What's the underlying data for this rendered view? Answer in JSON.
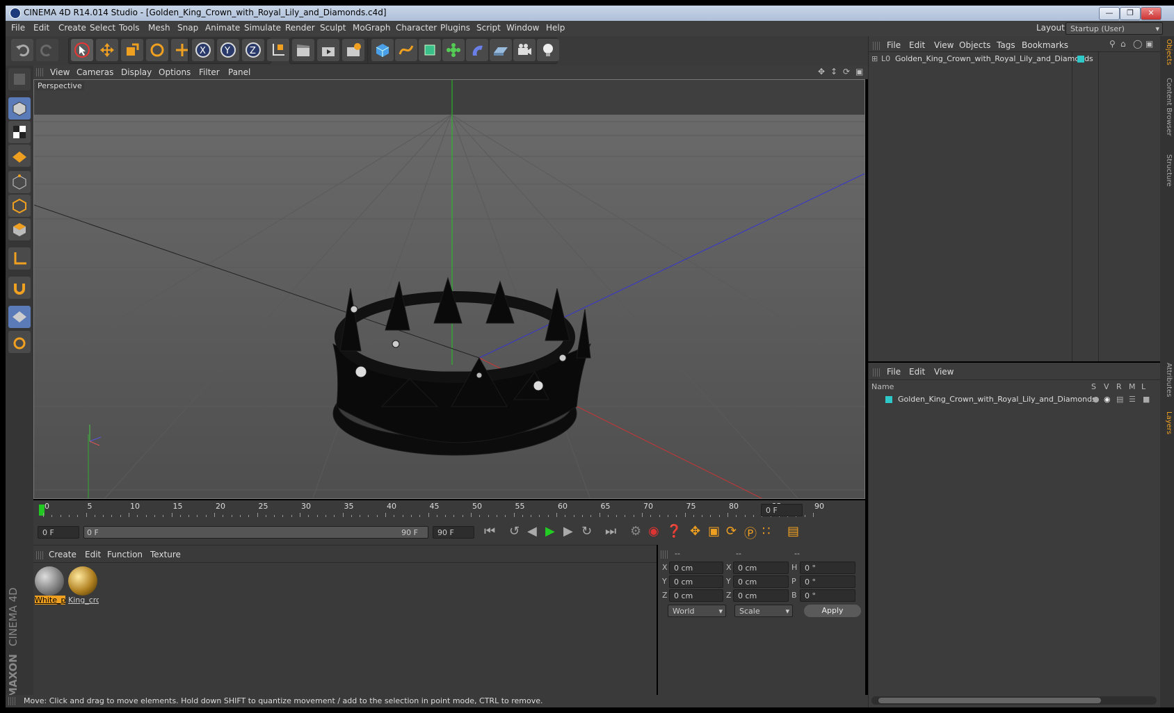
{
  "window": {
    "title": "CINEMA 4D R14.014 Studio - [Golden_King_Crown_with_Royal_Lily_and_Diamonds.c4d]"
  },
  "menu": [
    "File",
    "Edit",
    "Create",
    "Select",
    "Tools",
    "Mesh",
    "Snap",
    "Animate",
    "Simulate",
    "Render",
    "Sculpt",
    "MoGraph",
    "Character",
    "Plugins",
    "Script",
    "Window",
    "Help"
  ],
  "layout": {
    "label": "Layout:",
    "value": "Startup (User)"
  },
  "viewport": {
    "menu": [
      "View",
      "Cameras",
      "Display",
      "Options",
      "Filter",
      "Panel"
    ],
    "label": "Perspective"
  },
  "timeline": {
    "ticks": [
      "0",
      "5",
      "10",
      "15",
      "20",
      "25",
      "30",
      "35",
      "40",
      "45",
      "50",
      "55",
      "60",
      "65",
      "70",
      "75",
      "80",
      "85",
      "90"
    ],
    "current_frame": "0 F"
  },
  "playbar": {
    "start": "0 F",
    "range_start": "0 F",
    "range_end": "90 F",
    "end": "90 F"
  },
  "materials": {
    "menu": [
      "Create",
      "Edit",
      "Function",
      "Texture"
    ],
    "items": [
      {
        "name": "White_p"
      },
      {
        "name": "King_cro"
      }
    ]
  },
  "coords": {
    "headers": [
      "--",
      "--",
      "--"
    ],
    "rows": [
      {
        "a": "X",
        "av": "0 cm",
        "b": "X",
        "bv": "0 cm",
        "c": "H",
        "cv": "0 °"
      },
      {
        "a": "Y",
        "av": "0 cm",
        "b": "Y",
        "bv": "0 cm",
        "c": "P",
        "cv": "0 °"
      },
      {
        "a": "Z",
        "av": "0 cm",
        "b": "Z",
        "bv": "0 cm",
        "c": "B",
        "cv": "0 °"
      }
    ],
    "space": "World",
    "mode": "Scale",
    "apply": "Apply"
  },
  "objects": {
    "menu": [
      "File",
      "Edit",
      "View",
      "Objects",
      "Tags",
      "Bookmarks"
    ],
    "item": "Golden_King_Crown_with_Royal_Lily_and_Diamonds"
  },
  "layers": {
    "menu": [
      "File",
      "Edit",
      "View"
    ],
    "columns": {
      "name": "Name",
      "s": "S",
      "v": "V",
      "r": "R",
      "m": "M",
      "l": "L"
    },
    "item": "Golden_King_Crown_with_Royal_Lily_and_Diamonds"
  },
  "sidetabs": [
    "Objects",
    "Content Browser",
    "Structure",
    "Attributes",
    "Layers"
  ],
  "status": "Move: Click and drag to move elements. Hold down SHIFT to quantize movement / add to the selection in point mode, CTRL to remove.",
  "brand": {
    "line1": "MAXON",
    "line2": "CINEMA 4D"
  },
  "colors": {
    "accent": "#f0a020",
    "object_tag": "#2ec8c8"
  }
}
